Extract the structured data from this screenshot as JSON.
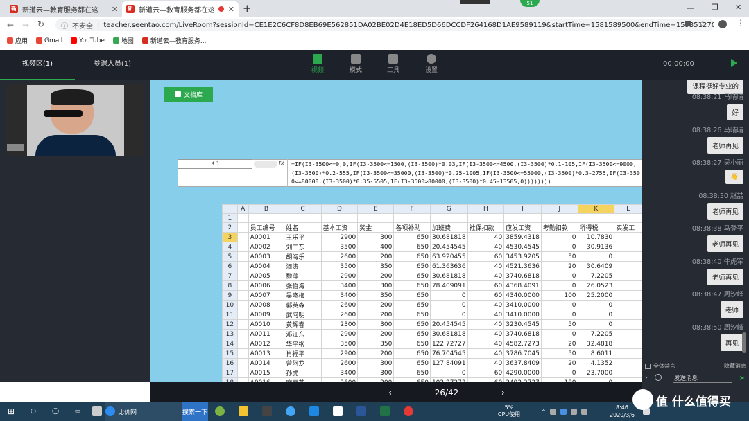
{
  "browser": {
    "tabs": [
      {
        "title": "新道云—教育服务都在这",
        "favicon": "新"
      },
      {
        "title": "新道云—教育服务都在这",
        "favicon": "新"
      }
    ],
    "new_tab": "+",
    "window_controls": [
      "—",
      "❐",
      "✕"
    ],
    "badge": "51",
    "security": "不安全",
    "url": "teacher.seentao.com/LiveRoom?sessionId=CE1E2C6CF8D8EB69E562851DA02BE02D4E18ED5D66DCCDF264168D1AE9589119&startTime=1581589500&endTime=1593512700...",
    "bookmarks": [
      {
        "label": "应用",
        "color": "#e74c3c"
      },
      {
        "label": "Gmail",
        "color": "#ea4335"
      },
      {
        "label": "YouTube",
        "color": "#ff0000"
      },
      {
        "label": "地图",
        "color": "#34a853"
      },
      {
        "label": "新道云—教育服务...",
        "color": "#d62d20"
      }
    ]
  },
  "left": {
    "tabs": [
      "视频区(1)",
      "参课人员(1)"
    ]
  },
  "top_nav": {
    "items": [
      {
        "label": "视频",
        "icon": "video-icon"
      },
      {
        "label": "模式",
        "icon": "grid-icon"
      },
      {
        "label": "工具",
        "icon": "toolbox-icon"
      },
      {
        "label": "设置",
        "icon": "gear-icon"
      }
    ],
    "timer": "00:00:00"
  },
  "content": {
    "doc_button": "文档库",
    "namebox": "K3",
    "fx": "fx",
    "formula": "=IF(I3-3500<=0,0,IF(I3-3500<=1500,(I3-3500)*0.03,IF(I3-3500<=4500,(I3-3500)*0.1-105,IF(I3-3500<=9000,(I3-3500)*0.2-555,IF(I3-3500<=35000,(I3-3500)*0.25-1005,IF(I3-3500<=55000,(I3-3500)*0.3-2755,IF(I3-3500<=80000,(I3-3500)*0.35-5505,IF(I3-3500>80000,(I3-3500)*0.45-13505,0))))))))",
    "columns": [
      "",
      "A",
      "B",
      "C",
      "D",
      "E",
      "F",
      "G",
      "H",
      "I",
      "J",
      "K",
      "L"
    ],
    "row1": "1",
    "headers": [
      "2",
      "",
      "员工编号",
      "姓名",
      "基本工资",
      "奖金",
      "各项补助",
      "加班费",
      "社保扣款",
      "应发工资",
      "考勤扣款",
      "所得税",
      "实发工"
    ],
    "rows": [
      [
        "3",
        "",
        "A0001",
        "王乐平",
        "2900",
        "300",
        "650",
        "30.681818",
        "40",
        "3859.4318",
        "0",
        "10.7830",
        ""
      ],
      [
        "4",
        "",
        "A0002",
        "刘二东",
        "3500",
        "400",
        "650",
        "20.454545",
        "40",
        "4530.4545",
        "0",
        "30.9136",
        ""
      ],
      [
        "5",
        "",
        "A0003",
        "胡海乐",
        "2600",
        "200",
        "650",
        "63.920455",
        "60",
        "3453.9205",
        "50",
        "0",
        ""
      ],
      [
        "6",
        "",
        "A0004",
        "海涛",
        "3500",
        "350",
        "650",
        "61.363636",
        "40",
        "4521.3636",
        "20",
        "30.6409",
        ""
      ],
      [
        "7",
        "",
        "A0005",
        "黎萍",
        "2900",
        "200",
        "650",
        "30.681818",
        "40",
        "3740.6818",
        "0",
        "7.2205",
        ""
      ],
      [
        "8",
        "",
        "A0006",
        "张伯海",
        "3400",
        "300",
        "650",
        "78.409091",
        "60",
        "4368.4091",
        "0",
        "26.0523",
        ""
      ],
      [
        "9",
        "",
        "A0007",
        "吴晓梅",
        "3400",
        "350",
        "650",
        "0",
        "60",
        "4340.0000",
        "100",
        "25.2000",
        ""
      ],
      [
        "10",
        "",
        "A0008",
        "郭英森",
        "2600",
        "200",
        "650",
        "0",
        "40",
        "3410.0000",
        "0",
        "0",
        ""
      ],
      [
        "11",
        "",
        "A0009",
        "武阿明",
        "2600",
        "200",
        "650",
        "0",
        "40",
        "3410.0000",
        "0",
        "0",
        ""
      ],
      [
        "12",
        "",
        "A0010",
        "黄辉春",
        "2300",
        "300",
        "650",
        "20.454545",
        "40",
        "3230.4545",
        "50",
        "0",
        ""
      ],
      [
        "13",
        "",
        "A0011",
        "邓江东",
        "2900",
        "200",
        "650",
        "30.681818",
        "40",
        "3740.6818",
        "0",
        "7.2205",
        ""
      ],
      [
        "14",
        "",
        "A0012",
        "华平纲",
        "3500",
        "350",
        "650",
        "122.72727",
        "40",
        "4582.7273",
        "20",
        "32.4818",
        ""
      ],
      [
        "15",
        "",
        "A0013",
        "肖福平",
        "2900",
        "200",
        "650",
        "76.704545",
        "40",
        "3786.7045",
        "50",
        "8.6011",
        ""
      ],
      [
        "16",
        "",
        "A0014",
        "曾阿龙",
        "2600",
        "300",
        "650",
        "127.84091",
        "40",
        "3637.8409",
        "20",
        "4.1352",
        ""
      ],
      [
        "17",
        "",
        "A0015",
        "孙虎",
        "3400",
        "300",
        "650",
        "0",
        "60",
        "4290.0000",
        "0",
        "23.7000",
        ""
      ],
      [
        "18",
        "",
        "A0016",
        "廖丽芳",
        "2600",
        "200",
        "650",
        "102.27273",
        "60",
        "3492.2727",
        "180",
        "0",
        ""
      ]
    ],
    "page": "26/42"
  },
  "chat": {
    "messages": [
      {
        "time": "",
        "text": "课程挺好专业的"
      },
      {
        "time": "08:38:21 马晴晴",
        "text": "好"
      },
      {
        "time": "08:38:26 马晴晴",
        "text": "老师再见"
      },
      {
        "time": "08:38:27 吴小丽",
        "text": "👋"
      },
      {
        "time": "08:38:30 赵喆",
        "text": "老师再见"
      },
      {
        "time": "08:38:38 马登平",
        "text": "老师再见"
      },
      {
        "time": "08:38:40 牛虎军",
        "text": "老师再见"
      },
      {
        "time": "08:38:47 周汐峰",
        "text": "老师"
      },
      {
        "time": "08:38:50 周汐峰",
        "text": "再见"
      }
    ],
    "mute_all": "全体禁言",
    "hide_msgs": "隐藏消息",
    "send_placeholder": "发送消息"
  },
  "taskbar": {
    "items": [
      "比价网",
      "搜索一下"
    ],
    "cpu": "5%",
    "cpu_label": "CPU使用",
    "time": "8:46",
    "date": "2020/3/6",
    "watermark": "值 什么值得买"
  }
}
